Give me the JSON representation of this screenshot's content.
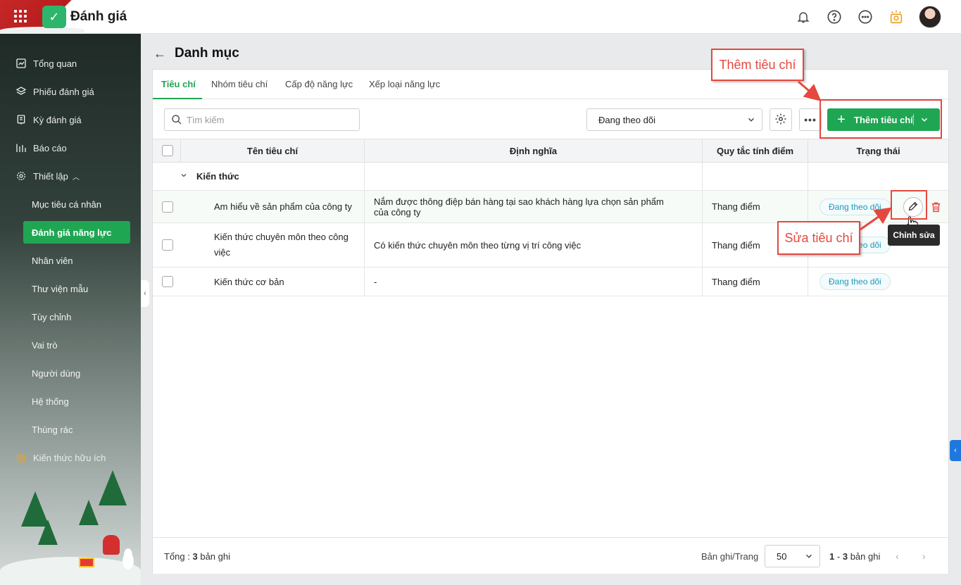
{
  "app": {
    "title": "Đánh giá"
  },
  "sidebar": {
    "items": [
      {
        "label": "Tổng quan",
        "icon": "chart-line-icon"
      },
      {
        "label": "Phiếu đánh giá",
        "icon": "layers-icon"
      },
      {
        "label": "Kỳ đánh giá",
        "icon": "clipboard-icon"
      },
      {
        "label": "Báo cáo",
        "icon": "bar-chart-icon"
      },
      {
        "label": "Thiết lập",
        "icon": "gear-icon"
      }
    ],
    "sub_items": [
      "Mục tiêu cá nhân",
      "Đánh giá năng lực",
      "Nhân viên",
      "Thư viện mẫu",
      "Tùy chỉnh",
      "Vai trò",
      "Người dùng",
      "Hệ thống",
      "Thùng rác"
    ],
    "active_sub": "Đánh giá năng lực",
    "extra": {
      "label": "Kiến thức hữu ích",
      "icon": "lightbulb-icon"
    }
  },
  "page": {
    "title": "Danh mục"
  },
  "tabs": [
    "Tiêu chí",
    "Nhóm tiêu chí",
    "Cấp độ năng lực",
    "Xếp loại năng lực"
  ],
  "toolbar": {
    "search_placeholder": "Tìm kiếm",
    "filter_value": "Đang theo dõi",
    "add_label": "Thêm tiêu chí"
  },
  "table": {
    "headers": [
      "Tên tiêu chí",
      "Định nghĩa",
      "Quy tắc tính điểm",
      "Trạng thái"
    ],
    "group": "Kiến thức",
    "rows": [
      {
        "name": "Am hiểu về sản phẩm của công ty",
        "definition": "Nắm được thông điệp bán hàng tại sao khách hàng lựa chọn sản phẩm của công ty",
        "rule": "Thang điểm",
        "status": "Đang theo dõi"
      },
      {
        "name": "Kiến thức chuyên môn theo công việc",
        "definition": "Có kiến thức chuyên môn theo từng vị trí công việc",
        "rule": "Thang điểm",
        "status": "Đang theo dõi"
      },
      {
        "name": "Kiến thức cơ bản",
        "definition": "-",
        "rule": "Thang điểm",
        "status": "Đang theo dõi"
      }
    ]
  },
  "footer": {
    "total_label": "Tổng :",
    "total_count": "3",
    "total_suffix": "bản ghi",
    "per_page_label": "Bản ghi/Trang",
    "per_page_value": "50",
    "range_start": "1",
    "range_sep": "-",
    "range_end": "3",
    "range_suffix": "bản ghi"
  },
  "annotations": {
    "add_callout": "Thêm tiêu chí",
    "edit_callout": "Sửa tiêu chí",
    "edit_tooltip": "Chỉnh sửa"
  },
  "colors": {
    "accent": "#1fa653",
    "annotation": "#e5483f",
    "badge_text": "#1a9ab8"
  }
}
